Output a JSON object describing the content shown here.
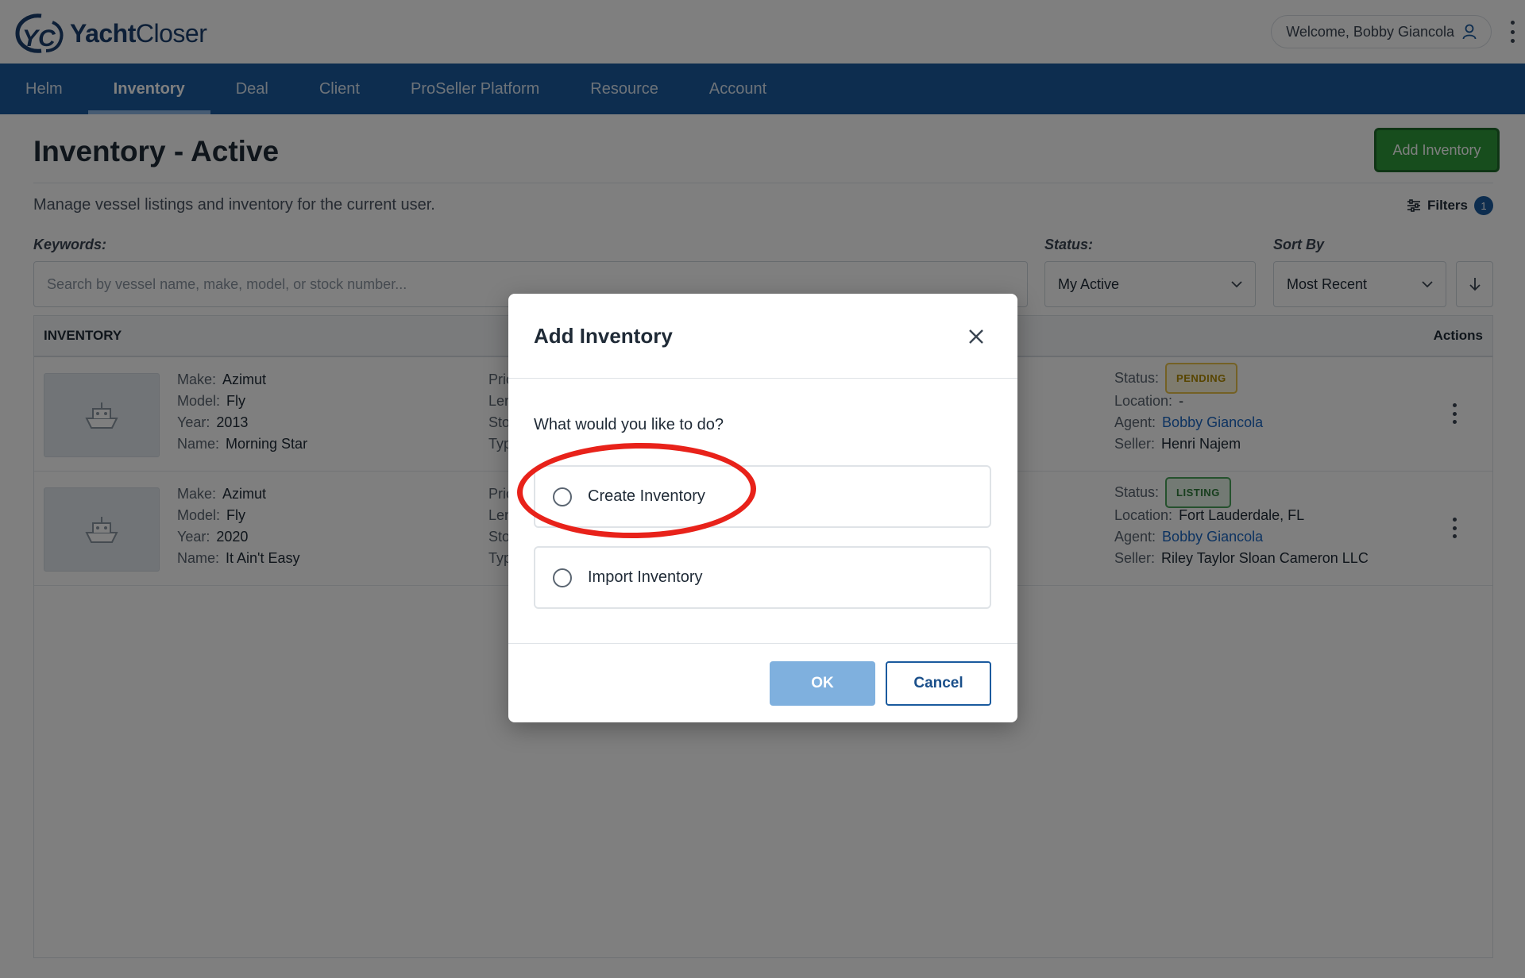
{
  "header": {
    "logo_text_bold": "Yacht",
    "logo_text_light": "Closer",
    "welcome": "Welcome, Bobby Giancola"
  },
  "nav": {
    "items": [
      {
        "label": "Helm"
      },
      {
        "label": "Inventory",
        "active": true
      },
      {
        "label": "Deal"
      },
      {
        "label": "Client"
      },
      {
        "label": "ProSeller Platform"
      },
      {
        "label": "Resource"
      },
      {
        "label": "Account"
      }
    ]
  },
  "page": {
    "title": "Inventory - Active",
    "add_button": "Add Inventory",
    "subtitle": "Manage vessel listings and inventory for the current user.",
    "filters_label": "Filters",
    "filters_count": "1"
  },
  "search": {
    "keywords_label": "Keywords:",
    "placeholder": "Search by vessel name, make, model, or stock number...",
    "status_label": "Status:",
    "status_value": "My Active",
    "sort_label": "Sort By",
    "sort_value": "Most Recent"
  },
  "table": {
    "header_left": "INVENTORY",
    "header_right": "Actions",
    "field_labels": {
      "make": "Make:",
      "model": "Model:",
      "year": "Year:",
      "name": "Name:",
      "status": "Status:",
      "location": "Location:",
      "agent": "Agent:",
      "seller": "Seller:"
    },
    "partial_labels": [
      "Pric",
      "Len",
      "Sto",
      "Typ"
    ],
    "rows": [
      {
        "make": "Azimut",
        "model": "Fly",
        "year": "2013",
        "name": "Morning Star",
        "status": "PENDING",
        "location": "-",
        "agent": "Bobby Giancola",
        "seller": "Henri Najem"
      },
      {
        "make": "Azimut",
        "model": "Fly",
        "year": "2020",
        "name": "It Ain't Easy",
        "status": "LISTING",
        "location": "Fort Lauderdale, FL",
        "agent": "Bobby Giancola",
        "seller": "Riley Taylor Sloan Cameron LLC"
      }
    ]
  },
  "modal": {
    "title": "Add Inventory",
    "question": "What would you like to do?",
    "options": [
      {
        "label": "Create Inventory",
        "selected": false
      },
      {
        "label": "Import Inventory",
        "selected": false
      }
    ],
    "ok_label": "OK",
    "cancel_label": "Cancel"
  },
  "colors": {
    "nav": "#1a5a9e",
    "add_button": "#2e9a3a",
    "pending": "#e8c24a",
    "listing": "#4aa35a",
    "highlight": "#e8221a"
  }
}
